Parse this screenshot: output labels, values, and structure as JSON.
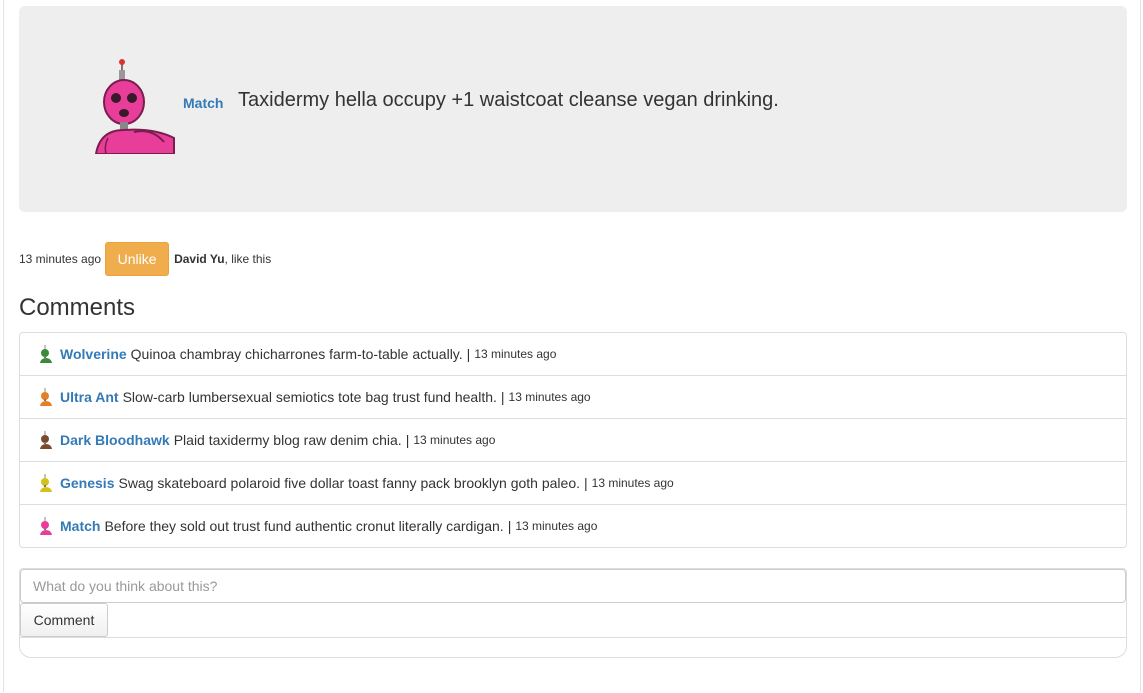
{
  "post": {
    "author": "Match",
    "text": "Taxidermy hella occupy +1 waistcoat cleanse vegan drinking.",
    "avatar_icon": "pink-robot-avatar"
  },
  "meta": {
    "time": "13 minutes ago",
    "unlike_label": "Unlike",
    "liker_name": "David Yu",
    "liker_suffix": ", like this"
  },
  "comments_heading": "Comments",
  "comments": [
    {
      "author": "Wolverine",
      "text": "Quinoa chambray chicharrones farm-to-table actually.",
      "separator": "|",
      "time": "13 minutes ago",
      "icon": "green-robot-icon",
      "color": "#3a8a3a"
    },
    {
      "author": "Ultra Ant",
      "text": "Slow-carb lumbersexual semiotics tote bag trust fund health.",
      "separator": "|",
      "time": "13 minutes ago",
      "icon": "orange-robot-icon",
      "color": "#e67e22"
    },
    {
      "author": "Dark Bloodhawk",
      "text": "Plaid taxidermy blog raw denim chia.",
      "separator": "|",
      "time": "13 minutes ago",
      "icon": "brown-robot-icon",
      "color": "#7a4a2a"
    },
    {
      "author": "Genesis",
      "text": "Swag skateboard polaroid five dollar toast fanny pack brooklyn goth paleo.",
      "separator": "|",
      "time": "13 minutes ago",
      "icon": "yellow-robot-icon",
      "color": "#d4c21c"
    },
    {
      "author": "Match",
      "text": "Before they sold out trust fund authentic cronut literally cardigan.",
      "separator": "|",
      "time": "13 minutes ago",
      "icon": "pink-robot-icon",
      "color": "#e83e9a"
    }
  ],
  "comment_form": {
    "placeholder": "What do you think about this?",
    "button_label": "Comment"
  },
  "colors": {
    "link": "#337ab7",
    "warning": "#f0ad4e",
    "card_bg": "#eeeeee"
  }
}
